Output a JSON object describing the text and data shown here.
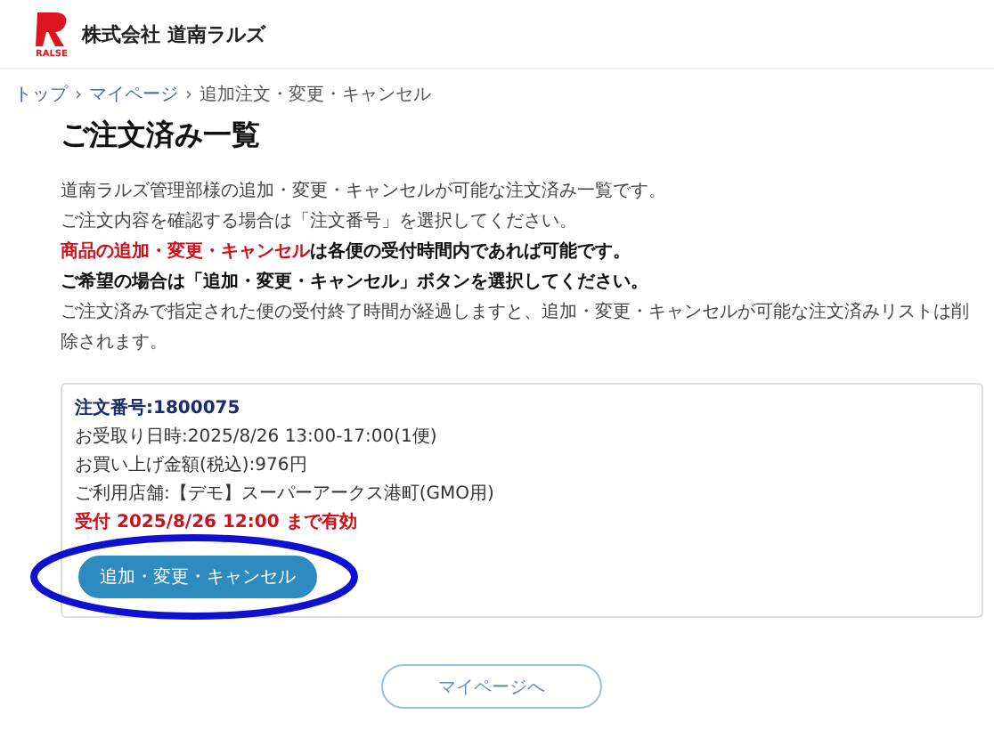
{
  "header": {
    "logo_text": "RALSE",
    "company": "株式会社 道南ラルズ"
  },
  "breadcrumb_separator": "›",
  "breadcrumb": [
    {
      "label": "トップ",
      "link": true
    },
    {
      "label": "マイページ",
      "link": true
    },
    {
      "label": "追加注文・変更・キャンセル",
      "link": false
    }
  ],
  "title": "ご注文済み一覧",
  "intro": [
    {
      "kind": "plain",
      "text": "道南ラルズ管理部様の追加・変更・キャンセルが可能な注文済み一覧です。"
    },
    {
      "kind": "plain",
      "text": "ご注文内容を確認する場合は「注文番号」を選択してください。"
    },
    {
      "kind": "notice",
      "highlight": "商品の追加・変更・キャンセル",
      "text": "は各便の受付時間内であれば可能です。"
    },
    {
      "kind": "bold",
      "text": "ご希望の場合は「追加・変更・キャンセル」ボタンを選択してください。"
    },
    {
      "kind": "plain",
      "text": "ご注文済みで指定された便の受付終了時間が経過しますと、追加・変更・キャンセルが可能な注文済みリストは削除されます。"
    }
  ],
  "orders": [
    {
      "order_number": "注文番号:1800075",
      "details": [
        "お受取り日時:2025/8/26 13:00-17:00(1便)",
        "お買い上げ金額(税込):976円",
        "ご利用店舗:【デモ】スーパーアークス港町(GMO用)"
      ],
      "deadline": "受付 2025/8/26 12:00 まで有効",
      "button": "追加・変更・キャンセル",
      "annotated": true
    }
  ],
  "back_button": "マイページへ"
}
